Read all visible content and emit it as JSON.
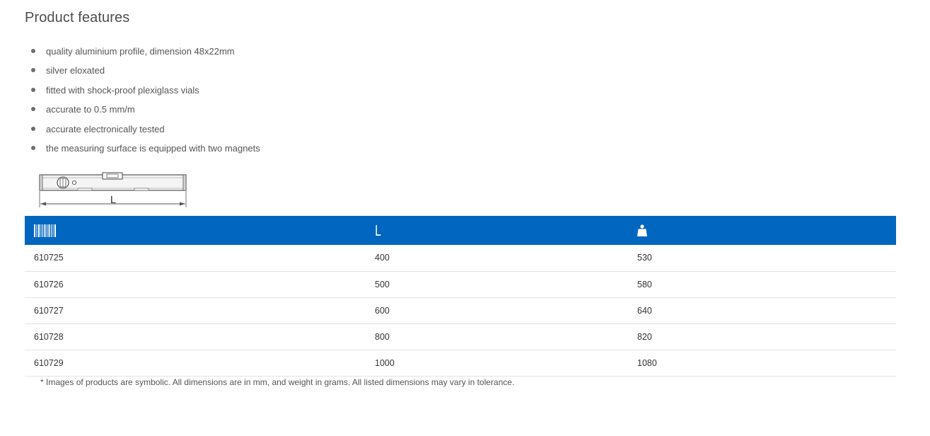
{
  "section": {
    "title": "Product features"
  },
  "features": [
    "quality aluminium profile, dimension 48x22mm",
    "silver eloxated",
    "fitted with shock-proof plexiglass vials",
    "accurate to 0.5 mm/m",
    "accurate electronically tested",
    "the measuring surface is equipped with two magnets"
  ],
  "diagram": {
    "dimension_label": "L"
  },
  "table": {
    "header": {
      "code_icon": "barcode-icon",
      "length_label": "L",
      "weight_icon": "weight-icon",
      "header_color": "#0066bf"
    },
    "rows": [
      {
        "code": "610725",
        "length": "400",
        "weight": "530"
      },
      {
        "code": "610726",
        "length": "500",
        "weight": "580"
      },
      {
        "code": "610727",
        "length": "600",
        "weight": "640"
      },
      {
        "code": "610728",
        "length": "800",
        "weight": "820"
      },
      {
        "code": "610729",
        "length": "1000",
        "weight": "1080"
      }
    ]
  },
  "note": "* Images of products are symbolic. All dimensions are in mm, and weight in grams. All listed dimensions may vary in tolerance."
}
